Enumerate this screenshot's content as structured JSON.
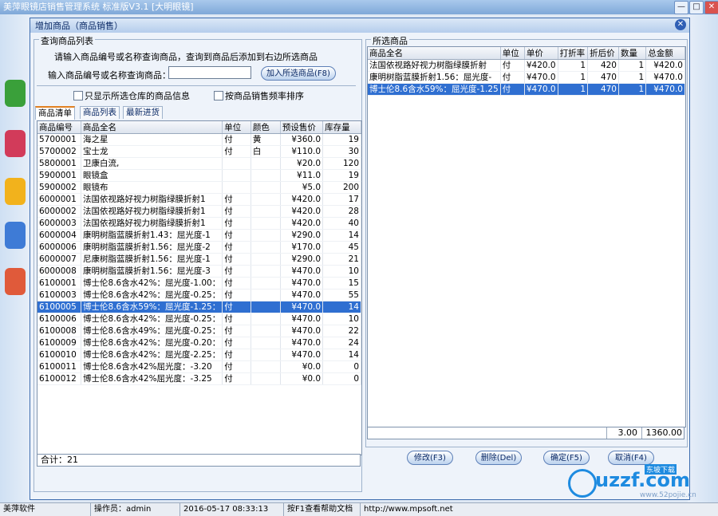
{
  "app": {
    "title": "美萍眼镜店销售管理系统 标准版V3.1 [大明眼镜]",
    "min": "—",
    "max": "□",
    "close": "✕"
  },
  "dialog": {
    "title": "增加商品（商品销售）",
    "close": "✕",
    "query": {
      "group_title": "查询商品列表",
      "hint": "请输入商品编号或名称查询商品，查询到商品后添加到右边所选商品",
      "input_label": "输入商品编号或名称查询商品：",
      "input_value": "",
      "add_button": "加入所选商品(F8)",
      "chk_only_all": "只显示所选仓库的商品信息",
      "chk_sort": "按商品销售频率排序"
    },
    "tabs": [
      "商品清单",
      "商品列表",
      "最新进货"
    ],
    "left_columns": [
      "商品编号",
      "商品全名",
      "单位",
      "颜色",
      "预设售价",
      "库存量"
    ],
    "left_rows": [
      [
        "5700001",
        "海之星",
        "付",
        "黄",
        "¥360.0",
        "19"
      ],
      [
        "5700002",
        "宝士龙",
        "付",
        "白",
        "¥110.0",
        "30"
      ],
      [
        "5800001",
        "卫康白流,",
        "",
        "",
        "¥20.0",
        "120"
      ],
      [
        "5900001",
        "眼镜盒",
        "",
        "",
        "¥11.0",
        "19"
      ],
      [
        "5900002",
        "眼镜布",
        "",
        "",
        "¥5.0",
        "200"
      ],
      [
        "6000001",
        "法国依视路好视力树脂绿膜折射1",
        "付",
        "",
        "¥420.0",
        "17"
      ],
      [
        "6000002",
        "法国依视路好视力树脂绿膜折射1",
        "付",
        "",
        "¥420.0",
        "28"
      ],
      [
        "6000003",
        "法国依视路好视力树脂绿膜折射1",
        "付",
        "",
        "¥420.0",
        "40"
      ],
      [
        "6000004",
        "康明树脂蓝膜折射1.43：屈光度-1",
        "付",
        "",
        "¥290.0",
        "14"
      ],
      [
        "6000006",
        "康明树脂蓝膜折射1.56：屈光度-2",
        "付",
        "",
        "¥170.0",
        "45"
      ],
      [
        "6000007",
        "尼康树脂蓝膜折射1.56：屈光度-1",
        "付",
        "",
        "¥290.0",
        "21"
      ],
      [
        "6000008",
        "康明树脂蓝膜折射1.56：屈光度-3",
        "付",
        "",
        "¥470.0",
        "10"
      ],
      [
        "6100001",
        "博士伦8.6含水42%：屈光度-1.00：",
        "付",
        "",
        "¥470.0",
        "15"
      ],
      [
        "6100003",
        "博士伦8.6含水42%：屈光度-0.25：",
        "付",
        "",
        "¥470.0",
        "55"
      ],
      [
        "6100005",
        "博士伦8.6含水59%：屈光度-1.25：",
        "付",
        "",
        "¥470.0",
        "14"
      ],
      [
        "6100006",
        "博士伦8.6含水42%：屈光度-0.25：",
        "付",
        "",
        "¥470.0",
        "10"
      ],
      [
        "6100008",
        "博士伦8.6含水49%：屈光度-0.25：",
        "付",
        "",
        "¥470.0",
        "22"
      ],
      [
        "6100009",
        "博士伦8.6含水42%：屈光度-0.20：",
        "付",
        "",
        "¥470.0",
        "24"
      ],
      [
        "6100010",
        "博士伦8.6含水42%：屈光度-2.25：",
        "付",
        "",
        "¥470.0",
        "14"
      ],
      [
        "6100011",
        "博士伦8.6含水42%屈光度：-3.20",
        "付",
        "",
        "¥0.0",
        "0"
      ],
      [
        "6100012",
        "博士伦8.6含水42%屈光度：-3.25",
        "付",
        "",
        "¥0.0",
        "0"
      ]
    ],
    "left_selected": 14,
    "total_label": "合计：21",
    "selected_group_title": "所选商品",
    "right_columns": [
      "商品全名",
      "单位",
      "单价",
      "打折率",
      "折后价",
      "数量",
      "总金额"
    ],
    "right_rows": [
      [
        "法国依视路好视力树脂绿膜折射",
        "付",
        "¥420.0",
        "1",
        "420",
        "1",
        "¥420.0"
      ],
      [
        "康明树脂蓝膜折射1.56：屈光度-",
        "付",
        "¥470.0",
        "1",
        "470",
        "1",
        "¥470.0"
      ],
      [
        "博士伦8.6含水59%：屈光度-1.25",
        "付",
        "¥470.0",
        "1",
        "470",
        "1",
        "¥470.0"
      ]
    ],
    "right_selected": 2,
    "sum_qty": "3.00",
    "sum_amount": "1360.00",
    "buttons": [
      "修改(F3)",
      "删除(Del)",
      "确定(F5)",
      "取消(F4)"
    ]
  },
  "status": {
    "company": "美萍软件",
    "operator": "操作员：admin",
    "datetime": "2016-05-17 08:33:13",
    "help": "按F1查看帮助文档",
    "url": "http://www.mpsoft.net"
  },
  "watermark": {
    "brand": "uzzf.com",
    "tag": "东坡下载",
    "site": "www.52pojie.cn"
  },
  "colors": {
    "selection": "#2f6fd1",
    "titlebar": "#7fa8d8"
  }
}
